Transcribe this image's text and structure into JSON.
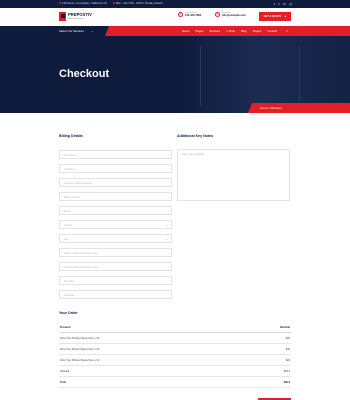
{
  "topbar": {
    "address": "149 Street, Los Angeles, California, US",
    "hours": "Mon - Sat: 8:00 - 18:00 / Sunday Closed",
    "social": [
      "f",
      "t",
      "in",
      "ig"
    ]
  },
  "header": {
    "logo_name": "PREPOSTIV",
    "logo_tagline": "Industrial & Factory",
    "call": {
      "label": "Call Us Now",
      "value": "123-456-7890"
    },
    "email": {
      "label": "Email Us",
      "value": "info@example.com"
    },
    "quote_label": "GET A QUOTE"
  },
  "nav": {
    "services_label": "Select Our Services",
    "menu": [
      "Home",
      "Pages",
      "Services",
      "+ Shop",
      "Blog",
      "Project",
      "Contact"
    ]
  },
  "banner": {
    "title": "Checkout",
    "breadcrumb": "Home  /  Checkout"
  },
  "billing": {
    "title": "Billing Details",
    "fields": [
      {
        "placeholder": "First Name"
      },
      {
        "placeholder": "Last Name"
      },
      {
        "placeholder": "Company name (optional)"
      },
      {
        "placeholder": "Phone Number"
      },
      {
        "placeholder": "Email"
      },
      {
        "placeholder": "Country",
        "select": true
      },
      {
        "placeholder": "City",
        "select": true
      },
      {
        "placeholder": "House number and street name"
      },
      {
        "placeholder": "House number and street name"
      },
      {
        "placeholder": "Zip code"
      },
      {
        "placeholder": "Postcode"
      }
    ]
  },
  "notes": {
    "title": "Additional Key Notes",
    "placeholder": "Order note (optional)"
  },
  "order": {
    "title": "Your Order",
    "head": {
      "product": "Products",
      "subtotal": "Subtotal"
    },
    "rows": [
      {
        "product": "Drop Your Product Name Here x 02",
        "price": "$25"
      },
      {
        "product": "Drop Your Product Name Here x 03",
        "price": "$30"
      },
      {
        "product": "Drop Your Product Name Here x 01",
        "price": "$20"
      }
    ],
    "subtotal": {
      "label": "Subtotal",
      "value": "$39.3"
    },
    "total": {
      "label": "Total",
      "value": "$39.3"
    }
  },
  "colors": {
    "accent": "#e21f26",
    "navy": "#0f1b3d"
  }
}
